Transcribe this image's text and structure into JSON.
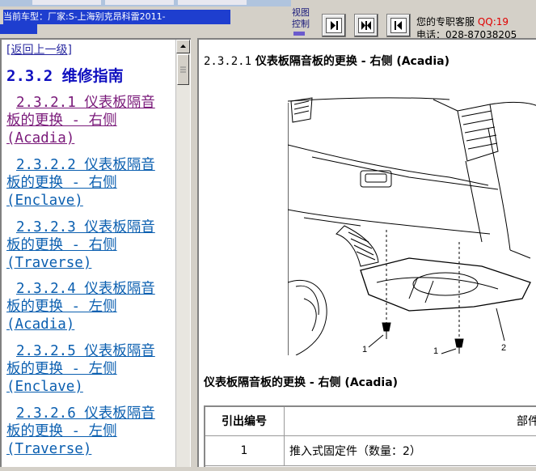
{
  "header": {
    "car_model": "当前车型：厂家:S-上海别克昂科雷2011-",
    "view_control": [
      "视图",
      "控制"
    ],
    "service_label": "您的专职客服",
    "qq_label": "QQ:19",
    "phone": "电话：028-87038205"
  },
  "toolbar": {
    "buttons": [
      {
        "name": "next-button",
        "icon": "arrow-right-bar-icon"
      },
      {
        "name": "expand-button",
        "icon": "arrows-outward-icon"
      },
      {
        "name": "previous-button",
        "icon": "arrow-left-bar-icon"
      }
    ]
  },
  "left_nav": {
    "back_label": "[返回上一级]",
    "section_title": "2.3.2 维修指南",
    "items": [
      {
        "line1": "2.3.2.1 仪表板隔音",
        "line2": "板的更换 - 右侧",
        "line3": "(Acadia)",
        "visited": true
      },
      {
        "line1": "2.3.2.2 仪表板隔音",
        "line2": "板的更换 - 右侧",
        "line3": "(Enclave)",
        "visited": false
      },
      {
        "line1": "2.3.2.3 仪表板隔音",
        "line2": "板的更换 - 右侧",
        "line3": "(Traverse)",
        "visited": false
      },
      {
        "line1": "2.3.2.4 仪表板隔音",
        "line2": "板的更换 - 左侧",
        "line3": "(Acadia)",
        "visited": false
      },
      {
        "line1": "2.3.2.5 仪表板隔音",
        "line2": "板的更换 - 左侧",
        "line3": "(Enclave)",
        "visited": false
      },
      {
        "line1": "2.3.2.6 仪表板隔音",
        "line2": "板的更换 - 左侧",
        "line3": "(Traverse)",
        "visited": false
      }
    ]
  },
  "document": {
    "heading_num": "2.3.2.1",
    "heading_text": "仪表板隔音板的更换 - 右侧 (Acadia)",
    "figure_callouts": [
      "1",
      "1",
      "2"
    ],
    "caption": "仪表板隔音板的更换 - 右侧 (Acadia)",
    "table": {
      "headers": [
        "引出编号",
        "部件名"
      ],
      "rows": [
        {
          "id": "1",
          "desc": "推入式固定件（数量：2）"
        }
      ]
    }
  },
  "colors": {
    "header_highlight": "#1e3ecf",
    "link": "#0b5fb0",
    "visited_link": "#7a1a7a",
    "section_title": "#1010c0",
    "qq": "#e00000"
  }
}
